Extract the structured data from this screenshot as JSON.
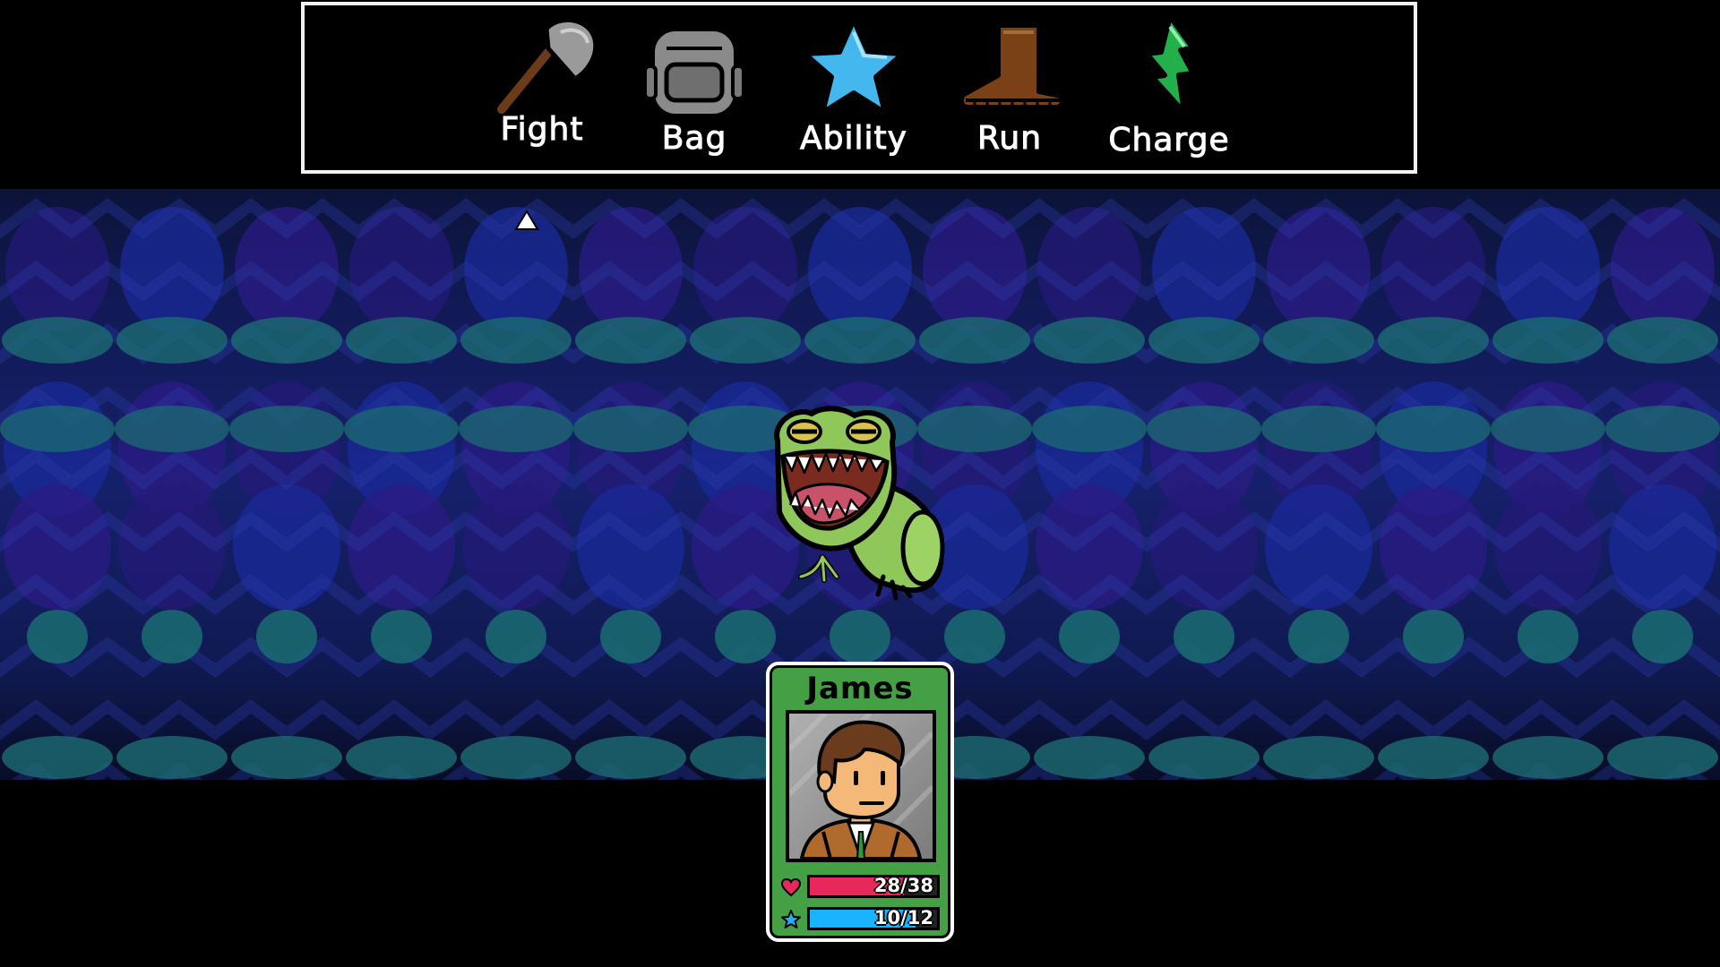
{
  "menu": {
    "items": [
      {
        "id": "fight",
        "label": "Fight",
        "icon": "axe-icon"
      },
      {
        "id": "bag",
        "label": "Bag",
        "icon": "backpack-icon"
      },
      {
        "id": "ability",
        "label": "Ability",
        "icon": "star-icon"
      },
      {
        "id": "run",
        "label": "Run",
        "icon": "boot-icon"
      },
      {
        "id": "charge",
        "label": "Charge",
        "icon": "lightning-icon"
      }
    ]
  },
  "enemy": {
    "icon": "frog-monster-icon"
  },
  "party": {
    "name": "James",
    "portrait_icon": "james-portrait-icon",
    "hp": {
      "current": 28,
      "max": 38,
      "text": "28/38",
      "color": "#e8275a",
      "icon": "heart-icon"
    },
    "mp": {
      "current": 10,
      "max": 12,
      "text": "10/12",
      "color": "#19b3ff",
      "icon": "star-icon"
    }
  },
  "colors": {
    "card": "#45a045",
    "background_teal": "#1a6f73",
    "background_blue": "#1c2a9a",
    "background_purple": "#3a1b8c"
  }
}
